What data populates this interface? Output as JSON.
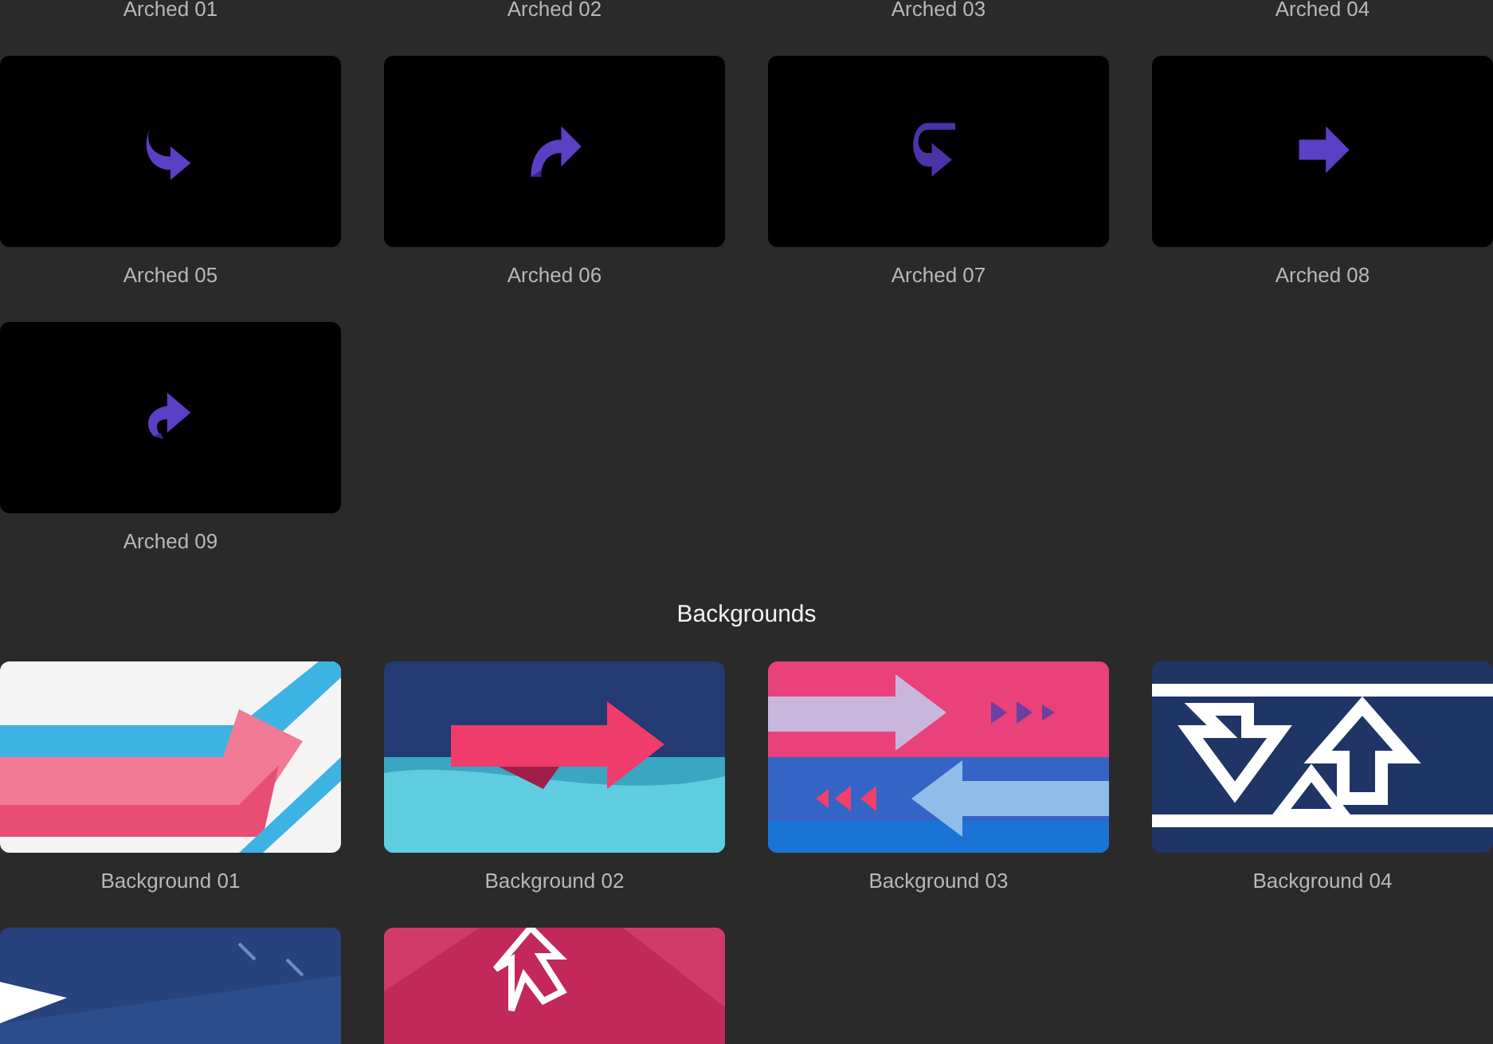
{
  "sections": [
    {
      "items": [
        {
          "label": "Arched 01",
          "kind": "label-only"
        },
        {
          "label": "Arched 02",
          "kind": "label-only"
        },
        {
          "label": "Arched 03",
          "kind": "label-only"
        },
        {
          "label": "Arched 04",
          "kind": "label-only"
        },
        {
          "label": "Arched 05",
          "kind": "clip"
        },
        {
          "label": "Arched 06",
          "kind": "clip"
        },
        {
          "label": "Arched 07",
          "kind": "clip"
        },
        {
          "label": "Arched 08",
          "kind": "clip"
        },
        {
          "label": "Arched 09",
          "kind": "clip"
        }
      ]
    },
    {
      "title": "Backgrounds",
      "items": [
        {
          "label": "Background 01",
          "kind": "picture"
        },
        {
          "label": "Background 02",
          "kind": "picture"
        },
        {
          "label": "Background 03",
          "kind": "picture"
        },
        {
          "label": "Background 04",
          "kind": "picture"
        },
        {
          "kind": "picture"
        },
        {
          "kind": "picture"
        }
      ]
    }
  ]
}
